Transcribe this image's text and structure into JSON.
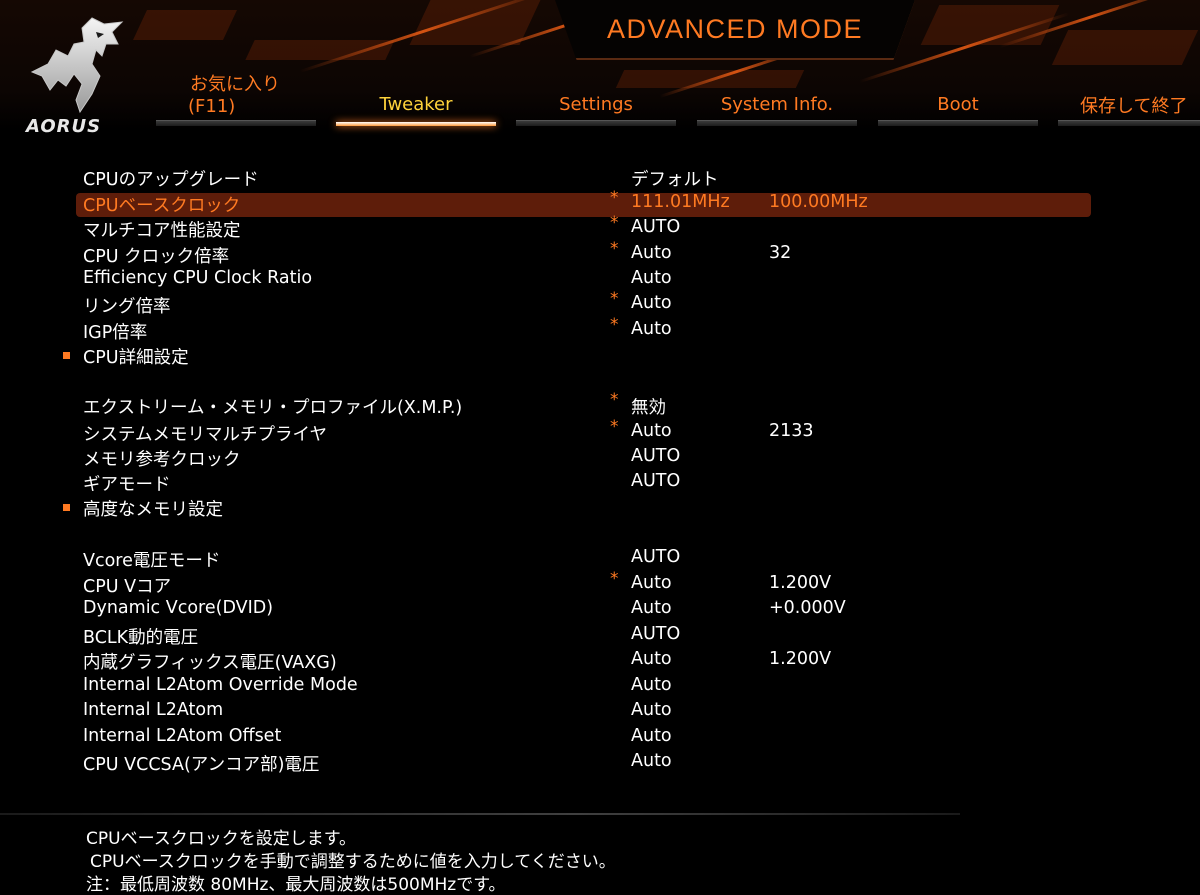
{
  "header": {
    "mode_title": "ADVANCED MODE",
    "brand": "AORUS"
  },
  "tabs": [
    {
      "line1": "お気に入り",
      "line2": "(F11)",
      "active": false
    },
    {
      "label": "Tweaker",
      "active": true
    },
    {
      "label": "Settings",
      "active": false
    },
    {
      "label": "System Info.",
      "active": false
    },
    {
      "label": "Boot",
      "active": false
    },
    {
      "label": "保存して終了",
      "active": false
    }
  ],
  "settings": {
    "cpu_upgrade": {
      "name": "CPUのアップグレード",
      "value": "デフォルト"
    },
    "cpu_base_clock": {
      "name": "CPUベースクロック",
      "value": "111.01MHz",
      "value2": "100.00MHz"
    },
    "multicore": {
      "name": "マルチコア性能設定",
      "value": "AUTO"
    },
    "cpu_clock_ratio": {
      "name": "CPU クロック倍率",
      "value": "Auto",
      "value2": "32"
    },
    "eff_cpu_ratio": {
      "name": "Efficiency CPU Clock Ratio",
      "value": "Auto"
    },
    "ring_ratio": {
      "name": "リング倍率",
      "value": "Auto"
    },
    "igp_ratio": {
      "name": "IGP倍率",
      "value": "Auto"
    },
    "cpu_detail": {
      "name": "CPU詳細設定"
    },
    "xmp": {
      "name": "エクストリーム・メモリ・プロファイル(X.M.P.)",
      "value": "無効"
    },
    "mem_multiplier": {
      "name": "システムメモリマルチプライヤ",
      "value": "Auto",
      "value2": "2133"
    },
    "mem_ref_clock": {
      "name": "メモリ参考クロック",
      "value": "AUTO"
    },
    "gear_mode": {
      "name": "ギアモード",
      "value": "AUTO"
    },
    "adv_mem": {
      "name": "高度なメモリ設定"
    },
    "vcore_mode": {
      "name": "Vcore電圧モード",
      "value": "AUTO"
    },
    "cpu_vcore": {
      "name": "CPU Vコア",
      "value": "Auto",
      "value2": "1.200V"
    },
    "dyn_vcore": {
      "name": "Dynamic Vcore(DVID)",
      "value": "Auto",
      "value2": "+0.000V"
    },
    "bclk_volt": {
      "name": "BCLK動的電圧",
      "value": "AUTO"
    },
    "vaxg": {
      "name": "内蔵グラフィックス電圧(VAXG)",
      "value": "Auto",
      "value2": "1.200V"
    },
    "l2atom_override": {
      "name": "Internal L2Atom Override Mode",
      "value": "Auto"
    },
    "l2atom": {
      "name": "Internal L2Atom",
      "value": "Auto"
    },
    "l2atom_offset": {
      "name": "Internal L2Atom Offset",
      "value": "Auto"
    },
    "vccsa": {
      "name": "CPU VCCSA(アンコア部)電圧",
      "value": "Auto"
    }
  },
  "help": {
    "line1": "CPUベースクロックを設定します。",
    "line2": "CPUベースクロックを手動で調整するために値を入力してください。",
    "line3": "注：最低周波数 80MHz、最大周波数は500MHzです。"
  },
  "colors": {
    "accent": "#ff7a22",
    "active_tab": "#ffd33b",
    "selection": "#5e1d0a",
    "background": "#000000"
  }
}
